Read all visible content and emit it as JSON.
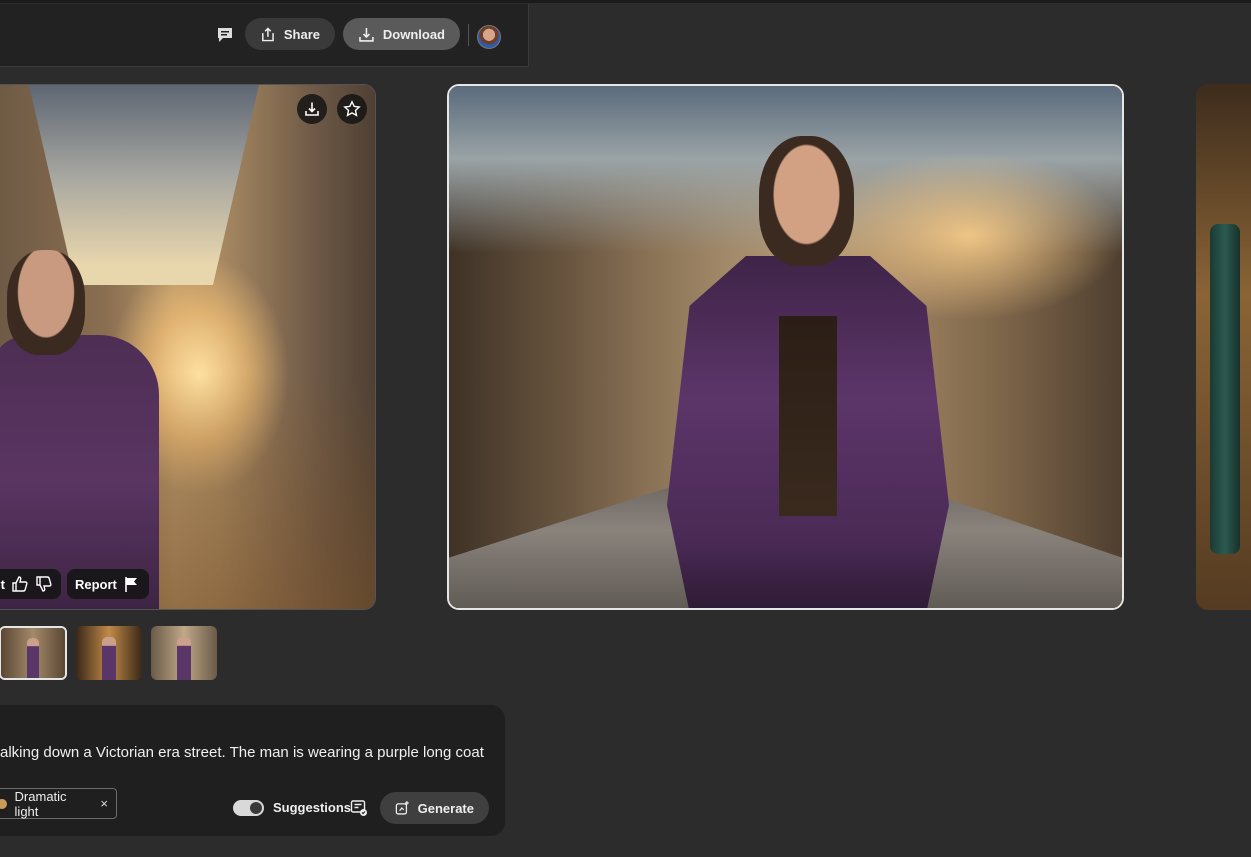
{
  "toolbar": {
    "comment_icon": "comment-icon",
    "share_label": "Share",
    "download_label": "Download",
    "share_icon": "share-icon",
    "download_icon": "download-icon"
  },
  "left_card": {
    "feedback_partial_label": "lt",
    "report_label": "Report"
  },
  "thumbnails": [
    {
      "selected": true
    },
    {
      "selected": false
    },
    {
      "selected": false
    }
  ],
  "prompt": {
    "text": "alking down a Victorian era street. The man is wearing a purple long coat",
    "style_tag": "Dramatic light",
    "tag_remove": "×",
    "suggestions_label": "Suggestions",
    "suggestions_on": true,
    "generate_label": "Generate"
  },
  "colors": {
    "background": "#2c2c2c",
    "panel": "#1f1f1f",
    "selected_border": "#e6e6e6",
    "download_button": "#5a5a5a"
  }
}
